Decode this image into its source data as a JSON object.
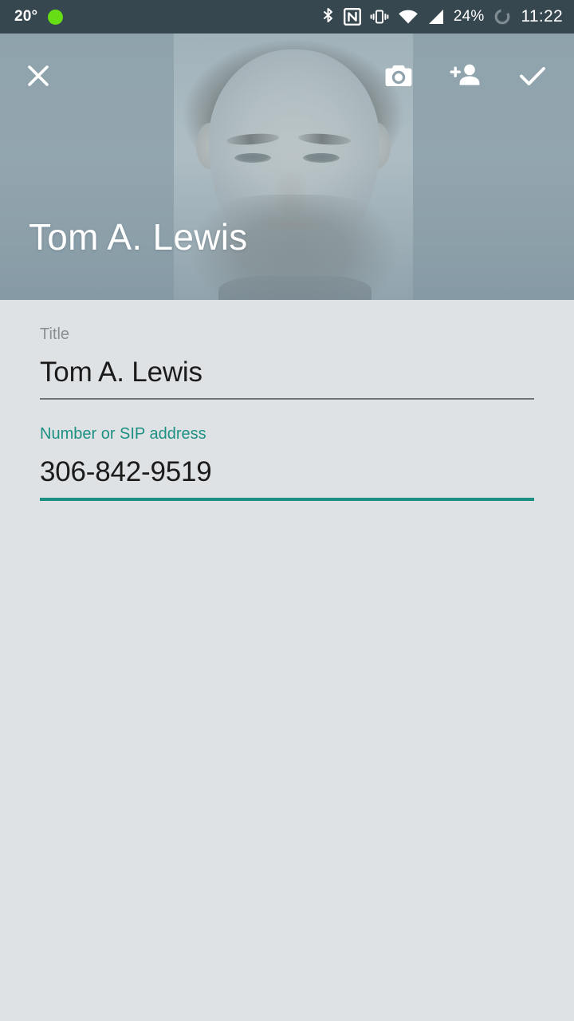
{
  "status_bar": {
    "temperature": "20°",
    "status_dot_color": "#66DD15",
    "icons": [
      "bluetooth-icon",
      "nfc-icon",
      "vibrate-icon",
      "wifi-icon",
      "cell-signal-icon",
      "battery-icon"
    ],
    "battery_percent": "24%",
    "time": "11:22",
    "background_color": "#37474F"
  },
  "toolbar": {
    "close_label": "close-icon",
    "camera_label": "camera-icon",
    "add_contact_label": "add-person-icon",
    "done_label": "check-icon"
  },
  "header": {
    "contact_name": "Tom A. Lewis",
    "photo_description": "bearded-man-portrait",
    "overlay_color": "#8FA3AD"
  },
  "form": {
    "background_color": "#DFE2E4",
    "accent_color": "#1C9183",
    "fields": [
      {
        "label": "Title",
        "value": "Tom A. Lewis",
        "focused": false,
        "label_color": "#8A8F92",
        "underline_color": "#6E7376"
      },
      {
        "label": "Number or SIP address",
        "value": "306-842-9519",
        "focused": true,
        "label_color": "#1C9183",
        "underline_color": "#1C9183"
      }
    ]
  }
}
